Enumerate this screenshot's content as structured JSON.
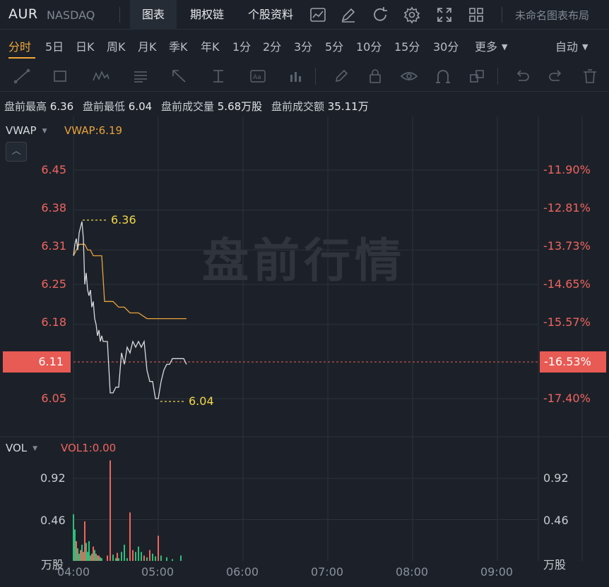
{
  "header": {
    "ticker": "AUR",
    "exchange": "NASDAQ",
    "tabs": [
      "图表",
      "期权链",
      "个股资料"
    ],
    "active_tab": "图表",
    "icons": [
      "indicator-icon",
      "draw-edit-icon",
      "refresh-icon",
      "settings-gear-icon",
      "fullscreen-icon",
      "layout-grid-icon"
    ],
    "layout_name": "未命名图表布局"
  },
  "periods": {
    "items": [
      "分时",
      "5日",
      "日K",
      "周K",
      "月K",
      "季K",
      "年K",
      "1分",
      "2分",
      "3分",
      "5分",
      "10分",
      "15分",
      "30分"
    ],
    "active": "分时",
    "more_label": "更多",
    "auto_label": "自动"
  },
  "drawing_tools": [
    "line-tool-icon",
    "rectangle-tool-icon",
    "wave-tool-icon",
    "fib-tool-icon",
    "arrow-tool-icon",
    "price-range-tool-icon",
    "text-tool-icon",
    "bar-tool-icon",
    "pencil-icon",
    "lock-icon",
    "eye-icon",
    "magnet-icon",
    "layers-icon",
    "undo-icon",
    "redo-icon",
    "trash-icon"
  ],
  "stats": {
    "high_label": "盘前最高",
    "high_value": "6.36",
    "low_label": "盘前最低",
    "low_value": "6.04",
    "volume_label": "盘前成交量",
    "volume_value": "5.68万股",
    "amount_label": "盘前成交额",
    "amount_value": "35.11万"
  },
  "price_panel": {
    "indicator_name": "VWAP",
    "indicator_value": "VWAP:6.19",
    "watermark": "盘前行情",
    "current_price": "6.11",
    "current_pct": "-16.53%",
    "high_marker": "6.36",
    "low_marker": "6.04",
    "colors": {
      "price_line": "#d8dadd",
      "vwap_line": "#e8a23a",
      "up": "#f0645e",
      "down": "#2fbf7a",
      "marker": "#f2d74a"
    }
  },
  "volume_panel": {
    "indicator_name": "VOL",
    "indicator_value": "VOL1:0.00",
    "unit_left": "万股",
    "unit_right": "万股"
  },
  "chart_data": {
    "type": "line",
    "title": "",
    "x_ticks": [
      "04:00",
      "05:00",
      "06:00",
      "07:00",
      "08:00",
      "09:00"
    ],
    "y_ticks_price": [
      "6.45",
      "6.38",
      "6.31",
      "6.25",
      "6.18",
      "6.05"
    ],
    "y_ticks_pct": [
      "-11.90%",
      "-12.81%",
      "-13.73%",
      "-14.65%",
      "-15.57%",
      "-17.40%"
    ],
    "y_ticks_volume": [
      "0.92",
      "0.46"
    ],
    "xlim_minutes": [
      0,
      300
    ],
    "ylim_price": [
      6.0,
      6.48
    ],
    "series": [
      {
        "name": "price",
        "x": [
          0,
          1,
          2,
          3,
          4,
          5,
          6,
          7,
          8,
          9,
          10,
          11,
          12,
          13,
          14,
          15,
          16,
          17,
          18,
          19,
          20,
          21,
          22,
          24,
          26,
          28,
          30,
          32,
          34,
          36,
          38,
          40,
          42,
          44,
          46,
          48,
          50,
          52,
          54,
          56,
          58,
          60,
          62,
          64,
          66,
          68,
          70,
          72,
          74,
          76,
          78,
          80
        ],
        "y": [
          6.3,
          6.32,
          6.33,
          6.31,
          6.34,
          6.35,
          6.36,
          6.33,
          6.25,
          6.27,
          6.24,
          6.23,
          6.24,
          6.21,
          6.22,
          6.19,
          6.18,
          6.16,
          6.17,
          6.15,
          6.16,
          6.15,
          6.15,
          6.15,
          6.06,
          6.06,
          6.07,
          6.07,
          6.13,
          6.11,
          6.14,
          6.13,
          6.15,
          6.14,
          6.15,
          6.14,
          6.15,
          6.1,
          6.08,
          6.08,
          6.05,
          6.05,
          6.08,
          6.1,
          6.11,
          6.11,
          6.12,
          6.12,
          6.12,
          6.12,
          6.12,
          6.11
        ]
      },
      {
        "name": "VWAP",
        "x": [
          0,
          2,
          4,
          6,
          8,
          10,
          12,
          14,
          16,
          18,
          20,
          22,
          24,
          28,
          32,
          36,
          40,
          46,
          52,
          56,
          60,
          66,
          72,
          80
        ],
        "y": [
          6.3,
          6.31,
          6.32,
          6.32,
          6.32,
          6.31,
          6.31,
          6.3,
          6.3,
          6.3,
          6.3,
          6.22,
          6.22,
          6.22,
          6.21,
          6.21,
          6.2,
          6.2,
          6.19,
          6.19,
          6.19,
          6.19,
          6.19,
          6.19
        ]
      }
    ],
    "volume": {
      "x": [
        0,
        1,
        2,
        3,
        4,
        5,
        6,
        7,
        8,
        9,
        10,
        11,
        12,
        13,
        14,
        15,
        16,
        17,
        18,
        19,
        20,
        24,
        26,
        28,
        30,
        31,
        32,
        34,
        36,
        38,
        40,
        42,
        44,
        46,
        48,
        50,
        52,
        54,
        56,
        58,
        60,
        62,
        66,
        70,
        76
      ],
      "y": [
        0.52,
        0.35,
        0.22,
        0.14,
        0.08,
        0.12,
        0.18,
        0.1,
        0.44,
        0.2,
        0.1,
        0.22,
        0.06,
        0.08,
        0.16,
        0.12,
        0.08,
        0.06,
        0.06,
        0.04,
        0.03,
        0.06,
        1.12,
        0.07,
        0.03,
        0.09,
        0.03,
        0.1,
        0.18,
        0.03,
        0.54,
        0.12,
        0.1,
        0.16,
        0.1,
        0.06,
        0.04,
        0.12,
        0.08,
        0.05,
        0.28,
        0.06,
        0.04,
        0.02,
        0.06
      ],
      "up": [
        true,
        true,
        false,
        true,
        true,
        false,
        true,
        false,
        false,
        true,
        true,
        true,
        false,
        true,
        false,
        true,
        false,
        true,
        false,
        true,
        true,
        false,
        false,
        true,
        true,
        false,
        true,
        true,
        true,
        true,
        false,
        false,
        true,
        true,
        true,
        false,
        true,
        false,
        true,
        true,
        false,
        true,
        true,
        true,
        true
      ],
      "ylim": [
        0,
        1.15
      ]
    }
  }
}
